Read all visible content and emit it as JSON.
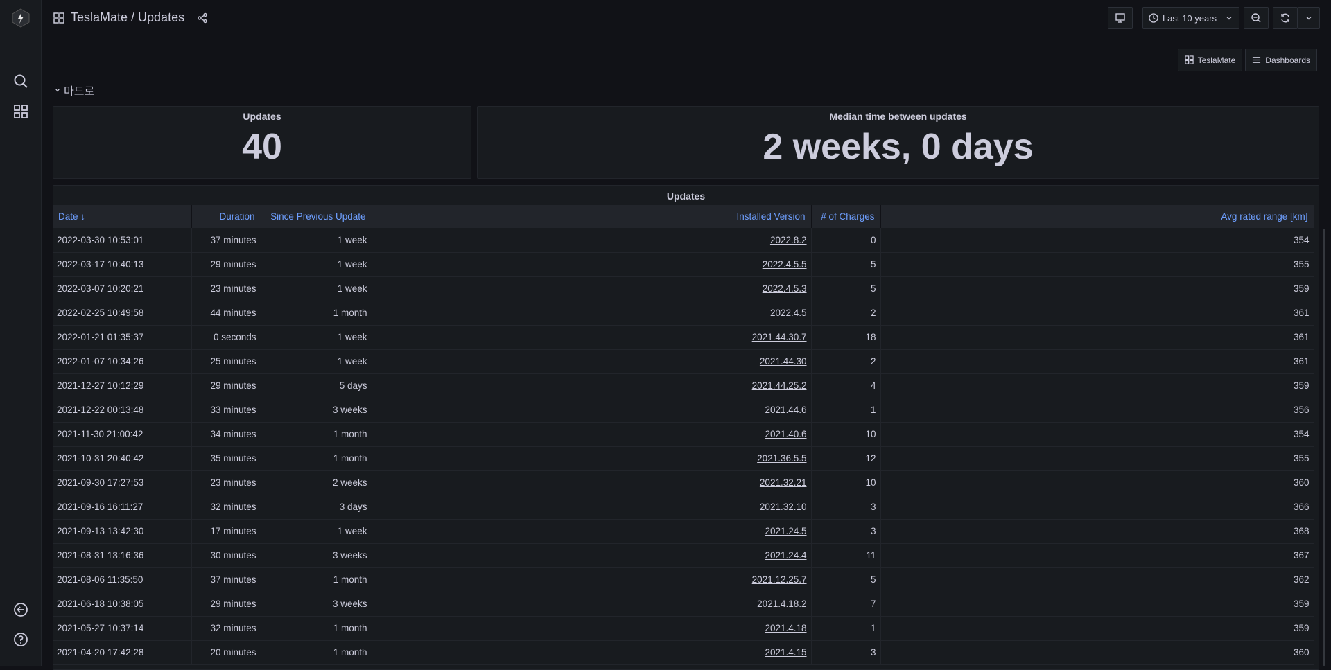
{
  "breadcrumb": {
    "title": "TeslaMate / Updates"
  },
  "toolbar": {
    "time_range": "Last 10 years"
  },
  "links": [
    {
      "label": "TeslaMate"
    },
    {
      "label": "Dashboards"
    }
  ],
  "row": {
    "title": "마드로"
  },
  "stat_updates": {
    "title": "Updates",
    "value": "40"
  },
  "stat_median": {
    "title": "Median time between updates",
    "value": "2 weeks, 0 days"
  },
  "table": {
    "title": "Updates",
    "columns": [
      "Date",
      "Duration",
      "Since Previous Update",
      "Installed Version",
      "# of Charges",
      "Avg rated range [km]"
    ],
    "sort_indicator": "↓",
    "rows": [
      [
        "2022-03-30 10:53:01",
        "37 minutes",
        "1 week",
        "2022.8.2",
        "0",
        "354"
      ],
      [
        "2022-03-17 10:40:13",
        "29 minutes",
        "1 week",
        "2022.4.5.5",
        "5",
        "355"
      ],
      [
        "2022-03-07 10:20:21",
        "23 minutes",
        "1 week",
        "2022.4.5.3",
        "5",
        "359"
      ],
      [
        "2022-02-25 10:49:58",
        "44 minutes",
        "1 month",
        "2022.4.5",
        "2",
        "361"
      ],
      [
        "2022-01-21 01:35:37",
        "0 seconds",
        "1 week",
        "2021.44.30.7",
        "18",
        "361"
      ],
      [
        "2022-01-07 10:34:26",
        "25 minutes",
        "1 week",
        "2021.44.30",
        "2",
        "361"
      ],
      [
        "2021-12-27 10:12:29",
        "29 minutes",
        "5 days",
        "2021.44.25.2",
        "4",
        "359"
      ],
      [
        "2021-12-22 00:13:48",
        "33 minutes",
        "3 weeks",
        "2021.44.6",
        "1",
        "356"
      ],
      [
        "2021-11-30 21:00:42",
        "34 minutes",
        "1 month",
        "2021.40.6",
        "10",
        "354"
      ],
      [
        "2021-10-31 20:40:42",
        "35 minutes",
        "1 month",
        "2021.36.5.5",
        "12",
        "355"
      ],
      [
        "2021-09-30 17:27:53",
        "23 minutes",
        "2 weeks",
        "2021.32.21",
        "10",
        "360"
      ],
      [
        "2021-09-16 16:11:27",
        "32 minutes",
        "3 days",
        "2021.32.10",
        "3",
        "366"
      ],
      [
        "2021-09-13 13:42:30",
        "17 minutes",
        "1 week",
        "2021.24.5",
        "3",
        "368"
      ],
      [
        "2021-08-31 13:16:36",
        "30 minutes",
        "3 weeks",
        "2021.24.4",
        "11",
        "367"
      ],
      [
        "2021-08-06 11:35:50",
        "37 minutes",
        "1 month",
        "2021.12.25.7",
        "5",
        "362"
      ],
      [
        "2021-06-18 10:38:05",
        "29 minutes",
        "3 weeks",
        "2021.4.18.2",
        "7",
        "359"
      ],
      [
        "2021-05-27 10:37:14",
        "32 minutes",
        "1 month",
        "2021.4.18",
        "1",
        "359"
      ],
      [
        "2021-04-20 17:42:28",
        "20 minutes",
        "1 month",
        "2021.4.15",
        "3",
        "360"
      ]
    ]
  },
  "colors": {
    "background": "#111217",
    "panel": "#181b1f",
    "header_text": "#6e9fff",
    "text": "#ccccdc"
  }
}
